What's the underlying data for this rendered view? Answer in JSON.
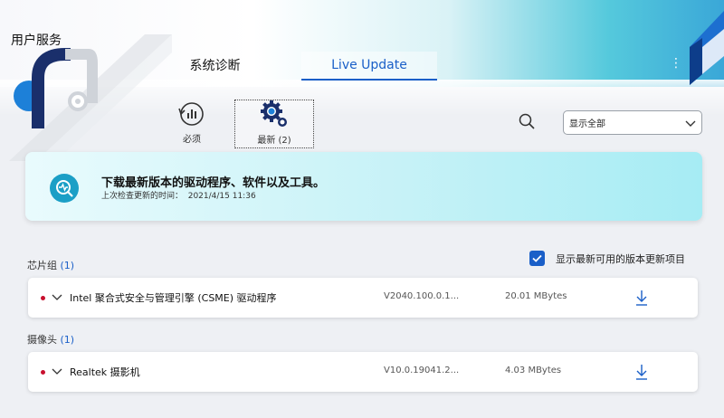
{
  "app": {
    "title": "用户服务"
  },
  "tabs": [
    {
      "label": "系统诊断",
      "active": false
    },
    {
      "label": "Live Update",
      "active": true
    }
  ],
  "more_icon": "⋮",
  "filters": {
    "required_label": "必须",
    "latest_label": "最新 (2)"
  },
  "dropdown": {
    "selected": "显示全部"
  },
  "banner": {
    "title": "下载最新版本的驱动程序、软件以及工具。",
    "last_checked": "上次检查更新的时间：  2021/4/15 11:36"
  },
  "show_latest_checkbox": {
    "label": "显示最新可用的版本更新项目",
    "checked": true
  },
  "sections": [
    {
      "name": "芯片组",
      "count": "(1)",
      "items": [
        {
          "name": "Intel 聚合式安全与管理引擎 (CSME) 驱动程序",
          "version": "V2040.100.0.1...",
          "size": "20.01 MBytes"
        }
      ]
    },
    {
      "name": "摄像头",
      "count": "(1)",
      "items": [
        {
          "name": "Realtek 摄影机",
          "version": "V10.0.19041.2...",
          "size": "4.03 MBytes"
        }
      ]
    }
  ],
  "colors": {
    "accent": "#1a5fc8",
    "status_dot": "#c8102e",
    "banner": "#c7f2f7",
    "header_cyan": "#55c9dc"
  },
  "icons": [
    "app-logo-icon",
    "more-icon",
    "required-icon",
    "latest-gear-icon",
    "search-icon",
    "chevron-down-icon",
    "update-scan-icon",
    "checkbox-checked-icon",
    "expand-chevron-icon",
    "download-icon"
  ]
}
